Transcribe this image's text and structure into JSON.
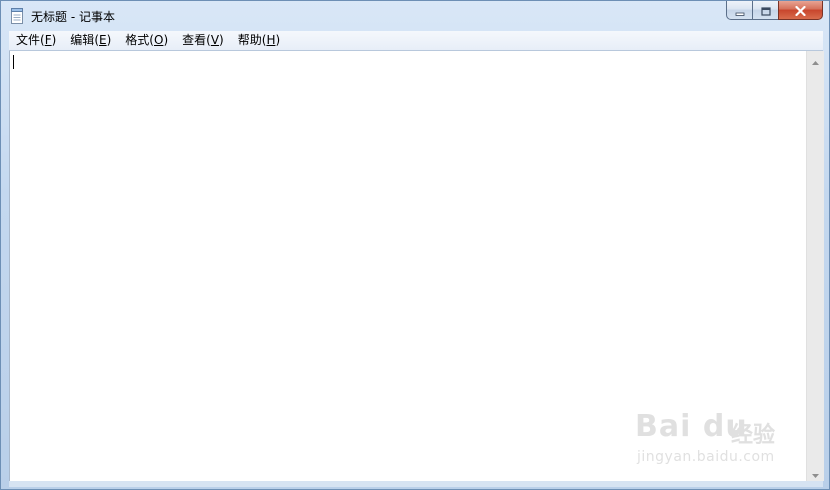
{
  "window": {
    "title": "无标题 - 记事本",
    "app_icon": "notepad-icon"
  },
  "caption_buttons": {
    "minimize_icon": "minimize-icon",
    "maximize_icon": "maximize-icon",
    "close_icon": "close-icon"
  },
  "menu": {
    "items": [
      {
        "label": "文件",
        "key": "F"
      },
      {
        "label": "编辑",
        "key": "E"
      },
      {
        "label": "格式",
        "key": "O"
      },
      {
        "label": "查看",
        "key": "V"
      },
      {
        "label": "帮助",
        "key": "H"
      }
    ]
  },
  "editor": {
    "content": ""
  },
  "watermark": {
    "logo": "Bai du",
    "cn": "经验",
    "url": "jingyan.baidu.com"
  },
  "colors": {
    "frame": "#c4d8ef",
    "close_button": "#c8452c",
    "menubar": "#f5f8fc"
  }
}
